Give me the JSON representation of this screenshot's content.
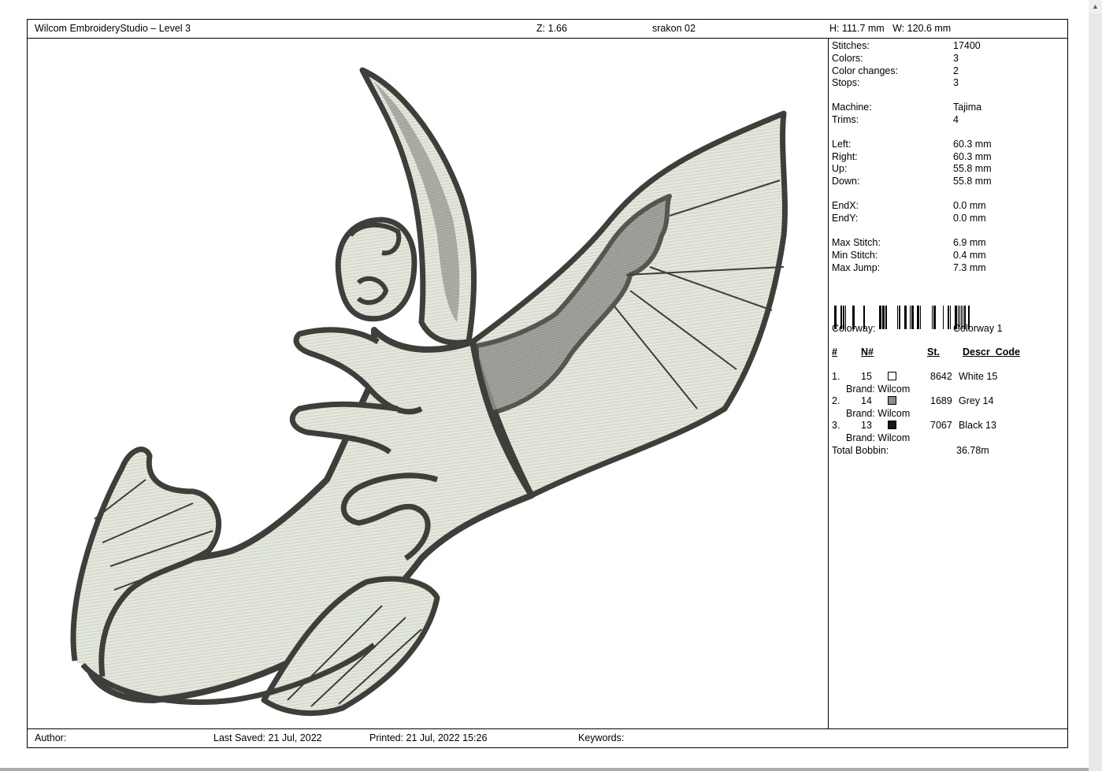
{
  "header": {
    "app_title": "Wilcom EmbroideryStudio – Level 3",
    "zoom": "Z: 1.66",
    "design_name": "srakon 02",
    "size": "H: 111.7 mm   W: 120.6 mm"
  },
  "stats": [
    {
      "label": "Stitches:",
      "value": "17400"
    },
    {
      "label": "Colors:",
      "value": "3"
    },
    {
      "label": "Color changes:",
      "value": "2"
    },
    {
      "label": "Stops:",
      "value": "3"
    },
    {
      "label": "Machine:",
      "value": "Tajima"
    },
    {
      "label": "Trims:",
      "value": "4"
    },
    {
      "label": "Left:",
      "value": "60.3 mm"
    },
    {
      "label": "Right:",
      "value": "60.3 mm"
    },
    {
      "label": "Up:",
      "value": "55.8 mm"
    },
    {
      "label": "Down:",
      "value": "55.8 mm"
    },
    {
      "label": "EndX:",
      "value": "0.0 mm"
    },
    {
      "label": "EndY:",
      "value": "0.0 mm"
    },
    {
      "label": "Max Stitch:",
      "value": "6.9 mm"
    },
    {
      "label": "Min Stitch:",
      "value": "0.4 mm"
    },
    {
      "label": "Max Jump:",
      "value": "7.3 mm"
    }
  ],
  "colorway": {
    "label": "Colorway:",
    "value": "Colorway 1"
  },
  "color_table": {
    "headers": {
      "num": "#",
      "n": "N#",
      "st": "St.",
      "descr": "Descr_Code"
    },
    "rows": [
      {
        "index": "1.",
        "code": "15",
        "swatch": "#ffffff",
        "stitches": "8642",
        "descr": "White 15",
        "brand": "Brand: Wilcom"
      },
      {
        "index": "2.",
        "code": "14",
        "swatch": "#8c8c8c",
        "stitches": "1689",
        "descr": "Grey 14",
        "brand": "Brand: Wilcom"
      },
      {
        "index": "3.",
        "code": "13",
        "swatch": "#161616",
        "stitches": "7067",
        "descr": "Black 13",
        "brand": "Brand: Wilcom"
      }
    ],
    "total_label": "Total Bobbin:",
    "total_value": "36.78m"
  },
  "footer": {
    "author": "Author:",
    "last_saved": "Last Saved: 21 Jul, 2022",
    "printed": "Printed: 21 Jul, 2022 15:26",
    "keywords": "Keywords:"
  },
  "colors": {
    "outline": "#3e3e3a",
    "fill_light": "#e6eadf",
    "fill_grey": "#8e908a"
  }
}
